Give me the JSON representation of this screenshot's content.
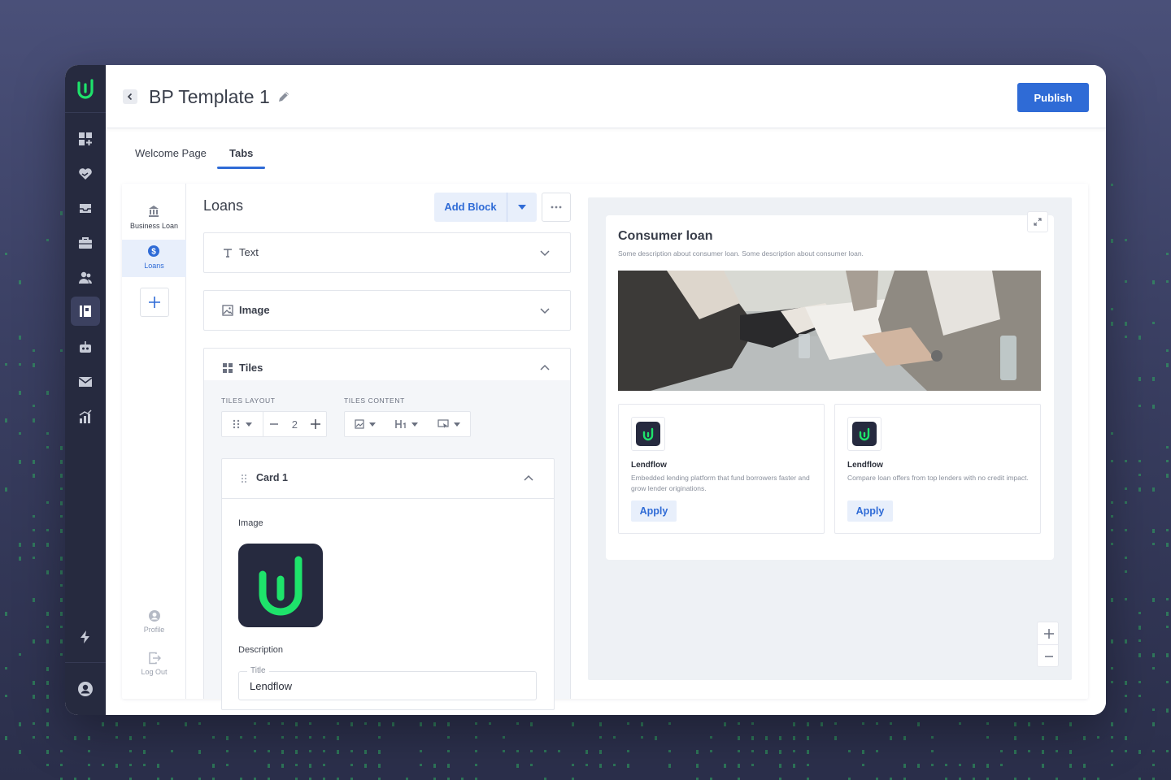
{
  "header": {
    "title": "BP Template 1",
    "publish_label": "Publish"
  },
  "tabs": [
    {
      "label": "Welcome Page",
      "active": false
    },
    {
      "label": "Tabs",
      "active": true
    }
  ],
  "subnav": {
    "items": [
      {
        "label": "Business Loan",
        "icon": "bank-icon",
        "active": false
      },
      {
        "label": "Loans",
        "icon": "dollar-icon",
        "active": true
      }
    ],
    "footer": [
      {
        "label": "Profile",
        "icon": "profile-icon"
      },
      {
        "label": "Log Out",
        "icon": "logout-icon"
      }
    ]
  },
  "blocks": {
    "title": "Loans",
    "add_block_label": "Add Block",
    "items": [
      {
        "label": "Text",
        "icon": "text-icon",
        "expanded": false
      },
      {
        "label": "Image",
        "icon": "image-icon",
        "expanded": false
      },
      {
        "label": "Tiles",
        "icon": "tiles-icon",
        "expanded": true
      }
    ],
    "tiles": {
      "layout_caption": "TILES LAYOUT",
      "content_caption": "TILES CONTENT",
      "columns_value": "2",
      "card": {
        "title": "Card 1",
        "image_label": "Image",
        "description_label": "Description",
        "title_field_caption": "Title",
        "title_field_value": "Lendflow"
      }
    }
  },
  "preview": {
    "title": "Consumer loan",
    "description": "Some description about consumer loan. Some description about consumer loan.",
    "tiles": [
      {
        "name": "Lendflow",
        "description": "Embedded lending platform that fund borrowers faster and grow lender originations.",
        "apply_label": "Apply"
      },
      {
        "name": "Lendflow",
        "description": "Compare loan offers from top lenders with no credit impact.",
        "apply_label": "Apply"
      }
    ]
  },
  "colors": {
    "accent": "#2f6bd6",
    "brand_green": "#1ee36b",
    "rail": "#262a3f"
  }
}
